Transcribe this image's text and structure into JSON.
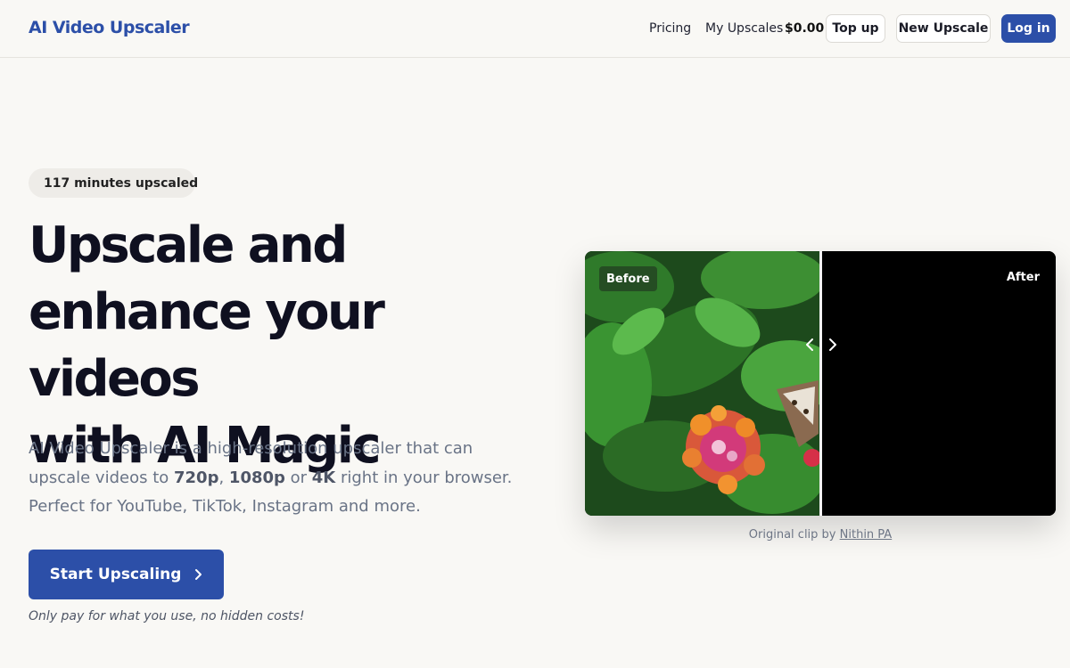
{
  "header": {
    "logo": "AI Video Upscaler",
    "nav": {
      "pricing": "Pricing",
      "my_upscales": "My Upscales"
    },
    "balance": "$0.00",
    "top_up": "Top up",
    "new_upscale": "New Upscale",
    "login": "Log in"
  },
  "hero": {
    "badge": "117 minutes upscaled",
    "headline_lines": [
      "Upscale and",
      "enhance your videos",
      "with AI Magic"
    ],
    "sub": {
      "p1": "AI Video Upscaler is a high-resolution upscaler that can upscale videos to ",
      "res1": "720p",
      "sep1": ", ",
      "res2": "1080p",
      "sep2": " or ",
      "res3": "4K",
      "p2": " right in your browser. Perfect for YouTube, TikTok, Instagram and more."
    },
    "cta": "Start Upscaling",
    "note": "Only pay for what you use, no hidden costs!"
  },
  "compare": {
    "before_label": "Before",
    "after_label": "After",
    "caption_prefix": "Original clip by ",
    "caption_author": "Nithin PA"
  },
  "colors": {
    "brand": "#2c4fa8",
    "background": "#f9f8f5",
    "heading": "#0f1020",
    "body_text": "#697386"
  },
  "icons": {
    "badge": "trending-up-icon",
    "cta": "chevron-right-icon",
    "handle_left": "chevron-left-icon",
    "handle_right": "chevron-right-icon"
  }
}
